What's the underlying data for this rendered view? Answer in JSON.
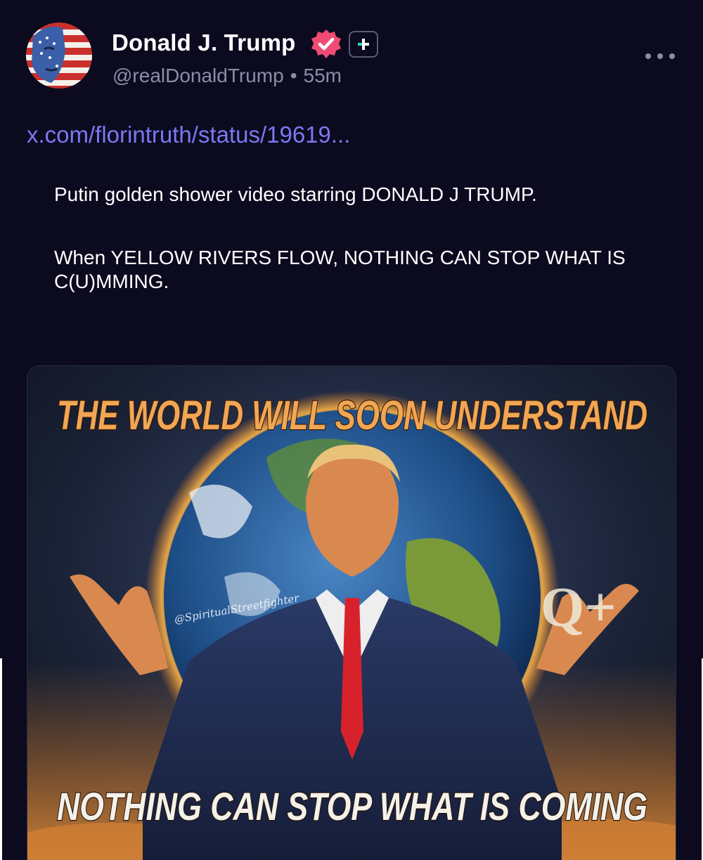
{
  "post": {
    "author": {
      "display_name": "Donald J. Trump",
      "handle": "@realDonaldTrump",
      "separator": "•",
      "time": "55m",
      "avatar_icon": "flag-face-avatar",
      "verified_icon": "verified-badge-icon",
      "plus_icon": "plus-badge-icon"
    },
    "more_icon": "more-options-icon",
    "link_text": "x.com/florintruth/status/19619...",
    "quote_lines": [
      "Putin golden shower video starring DONALD J TRUMP.",
      "When YELLOW RIVERS FLOW, NOTHING CAN STOP WHAT IS C(U)MMING."
    ],
    "media": {
      "headline": "THE WORLD WILL SOON UNDERSTAND",
      "footer_text": "NOTHING CAN STOP WHAT IS COMING",
      "watermark": "@SpiritualStreetfighter",
      "corner_mark": "Q+"
    }
  },
  "colors": {
    "background": "#0b0a1f",
    "link": "#7d78f0",
    "muted": "#8e8da8",
    "verified": "#ef4c74",
    "headline": "#f0a654"
  }
}
